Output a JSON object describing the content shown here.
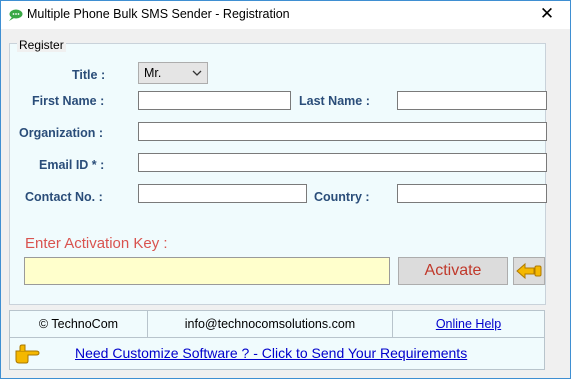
{
  "window": {
    "title": "Multiple Phone Bulk SMS Sender - Registration",
    "close_glyph": "✕"
  },
  "register": {
    "legend": "Register",
    "title_label": "Title :",
    "title_value": "Mr.",
    "first_name_label": "First Name :",
    "first_name_value": "",
    "last_name_label": "Last Name :",
    "last_name_value": "",
    "organization_label": "Organization :",
    "organization_value": "",
    "email_label": "Email ID * :",
    "email_value": "",
    "contact_label": "Contact No. :",
    "contact_value": "",
    "country_label": "Country :",
    "country_value": ""
  },
  "activation": {
    "label": "Enter Activation Key  :",
    "key_value": "",
    "activate_label": "Activate",
    "back_icon": "back-arrow-hand-icon"
  },
  "footer": {
    "copyright": "© TechnoCom",
    "email": "info@technocomsolutions.com",
    "help_link": "Online Help",
    "custom_link": "Need Customize Software ? - Click to Send Your Requirements",
    "hand_icon": "pointing-hand-icon"
  },
  "colors": {
    "label_blue": "#2a4d79",
    "activation_red": "#d9534f",
    "key_bg": "#ffffcc",
    "link_blue": "#0000cc"
  }
}
